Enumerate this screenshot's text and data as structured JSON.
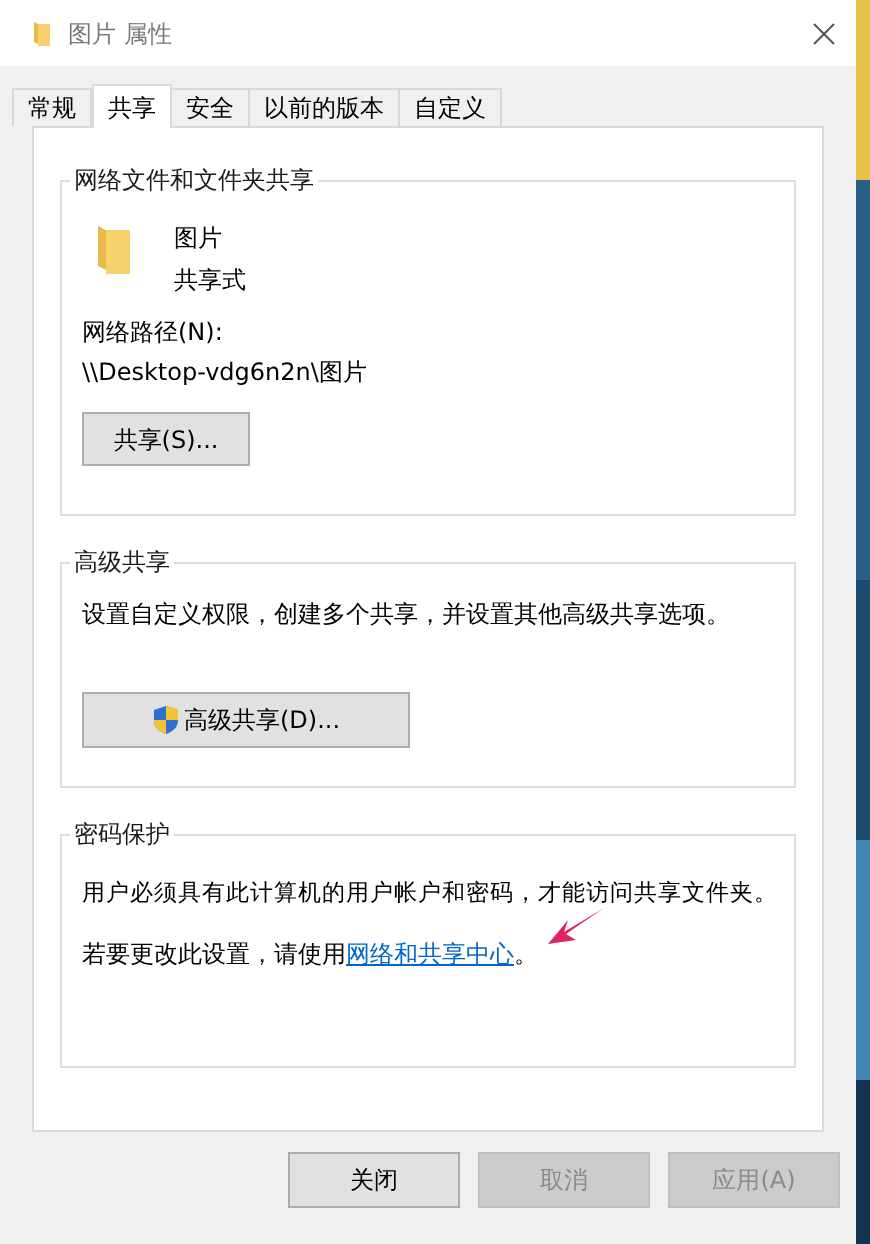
{
  "window": {
    "title": "图片 属性"
  },
  "tabs": [
    {
      "label": "常规",
      "selected": false
    },
    {
      "label": "共享",
      "selected": true
    },
    {
      "label": "安全",
      "selected": false
    },
    {
      "label": "以前的版本",
      "selected": false
    },
    {
      "label": "自定义",
      "selected": false
    }
  ],
  "network_sharing": {
    "title": "网络文件和文件夹共享",
    "folder_name": "图片",
    "share_state": "共享式",
    "path_label": "网络路径(N):",
    "path": "\\\\Desktop-vdg6n2n\\图片",
    "button": "共享(S)..."
  },
  "advanced_sharing": {
    "title": "高级共享",
    "description": "设置自定义权限，创建多个共享，并设置其他高级共享选项。",
    "button": "高级共享(D)..."
  },
  "password_protection": {
    "title": "密码保护",
    "description": "用户必须具有此计算机的用户帐户和密码，才能访问共享文件夹。",
    "hint_prefix": "若要更改此设置，请使用",
    "link": "网络和共享中心",
    "hint_suffix": "。"
  },
  "buttons": [
    {
      "label": "关闭",
      "disabled": false
    },
    {
      "label": "取消",
      "disabled": true
    },
    {
      "label": "应用(A)",
      "disabled": true
    }
  ]
}
